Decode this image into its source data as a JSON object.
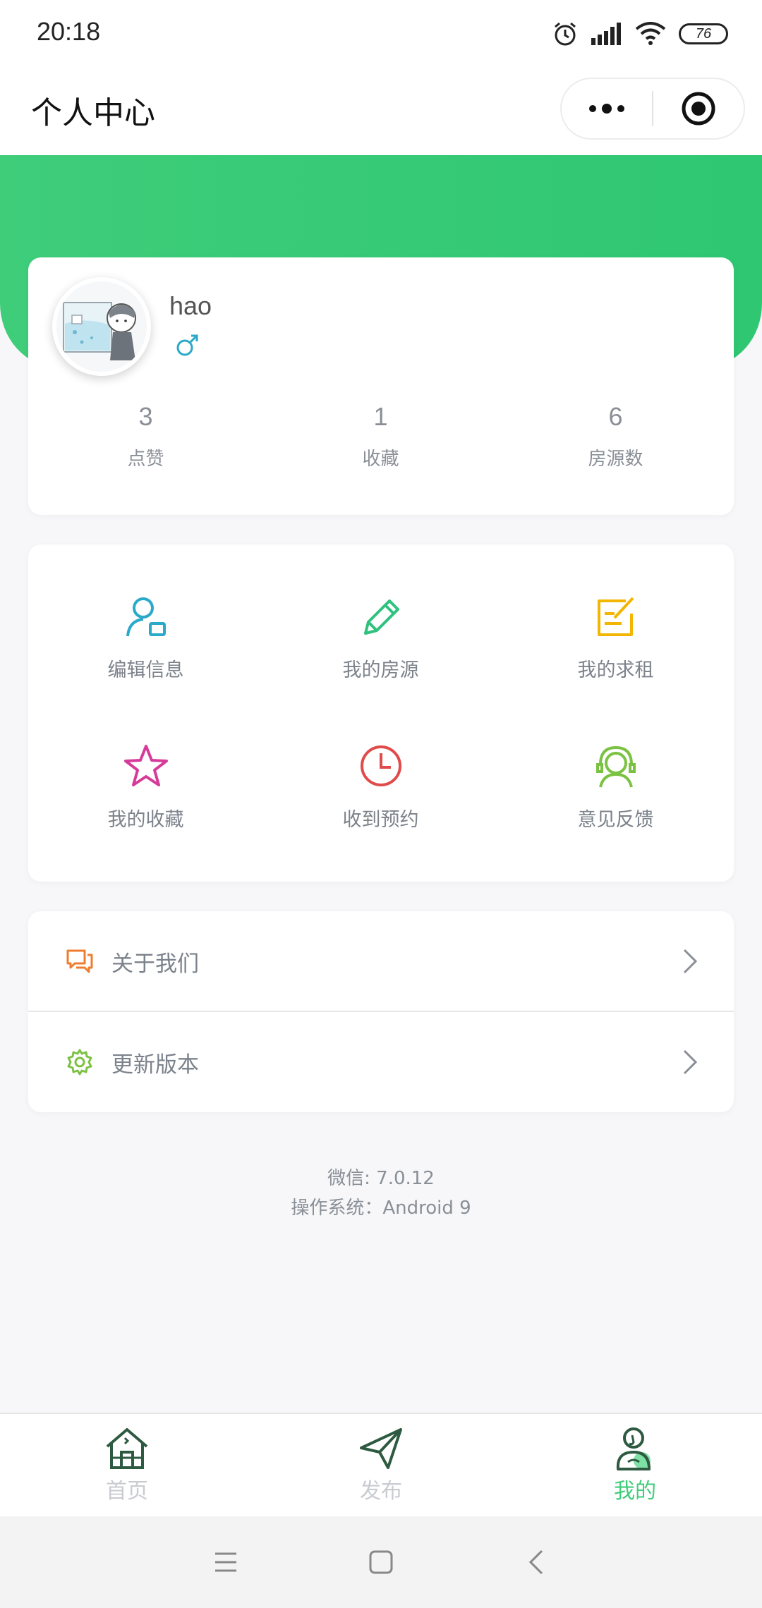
{
  "status_bar": {
    "time": "20:18",
    "battery": "76"
  },
  "header": {
    "title": "个人中心"
  },
  "profile": {
    "username": "hao",
    "gender": "♂"
  },
  "stats": [
    {
      "value": "3",
      "label": "点赞"
    },
    {
      "value": "1",
      "label": "收藏"
    },
    {
      "value": "6",
      "label": "房源数"
    }
  ],
  "menu": [
    {
      "label": "编辑信息",
      "icon": "edit-profile-icon",
      "color": "#2aa9c9"
    },
    {
      "label": "我的房源",
      "icon": "pencil-icon",
      "color": "#2ec27e"
    },
    {
      "label": "我的求租",
      "icon": "note-edit-icon",
      "color": "#f2b600"
    },
    {
      "label": "我的收藏",
      "icon": "star-icon",
      "color": "#d63b9a"
    },
    {
      "label": "收到预约",
      "icon": "clock-icon",
      "color": "#e04b4b"
    },
    {
      "label": "意见反馈",
      "icon": "headset-icon",
      "color": "#7cc242"
    }
  ],
  "list": [
    {
      "label": "关于我们",
      "icon": "chat-icon",
      "color": "#ef7d2f"
    },
    {
      "label": "更新版本",
      "icon": "gear-icon",
      "color": "#7cc242"
    }
  ],
  "footer": {
    "wechat": "微信: 7.0.12",
    "os": "操作系统：Android 9"
  },
  "tabs": [
    {
      "label": "首页",
      "icon": "home-icon"
    },
    {
      "label": "发布",
      "icon": "send-icon"
    },
    {
      "label": "我的",
      "icon": "user-icon",
      "active": true
    }
  ],
  "colors": {
    "brand": "#3fcd7a",
    "muted": "#8a8f97"
  }
}
